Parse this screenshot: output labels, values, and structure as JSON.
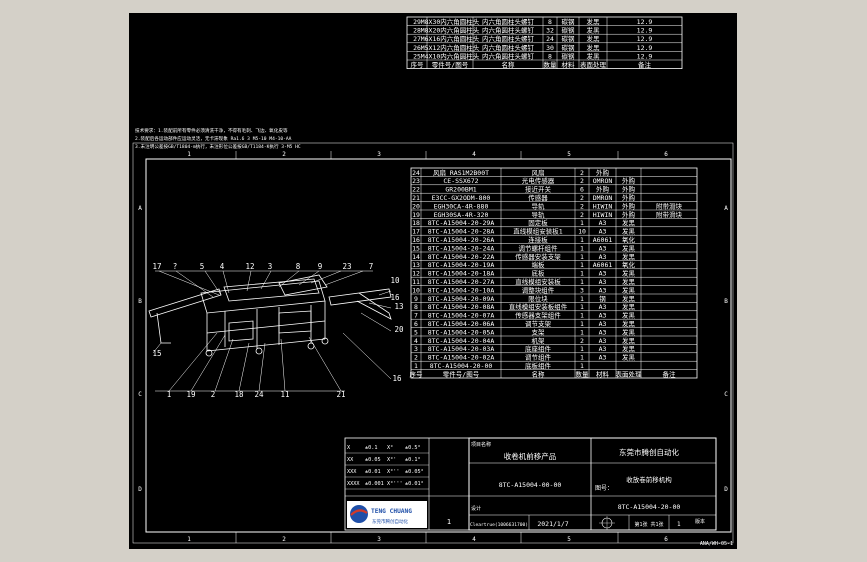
{
  "top_bom": {
    "rows": [
      {
        "no": "29",
        "part": "M8X30内六角圆柱头",
        "name": "内六角圆柱头螺钉",
        "qty": "8",
        "mat": "碳钢",
        "mark": "发黑",
        "spec": "12.9"
      },
      {
        "no": "28",
        "part": "M8X20内六角圆柱头",
        "name": "内六角圆柱头螺钉",
        "qty": "32",
        "mat": "碳钢",
        "mark": "发黑",
        "spec": "12.9"
      },
      {
        "no": "27",
        "part": "M6X16内六角圆柱头",
        "name": "内六角圆柱头螺钉",
        "qty": "24",
        "mat": "碳钢",
        "mark": "发黑",
        "spec": "12.9"
      },
      {
        "no": "26",
        "part": "M5X12内六角圆柱头",
        "name": "内六角圆柱头螺钉",
        "qty": "30",
        "mat": "碳钢",
        "mark": "发黑",
        "spec": "12.9"
      },
      {
        "no": "25",
        "part": "M4X10内六角圆柱头",
        "name": "内六角圆柱头螺钉",
        "qty": "8",
        "mat": "碳钢",
        "mark": "发黑",
        "spec": "12.9"
      }
    ],
    "header": {
      "no": "序号",
      "part": "零件号/图号",
      "name": "名称",
      "qty": "数量",
      "mat": "材料",
      "mark": "表面处理",
      "spec": "备注"
    }
  },
  "notes": [
    "技术要求：1.装配前所有零件必须清洗干净，不得有毛刺、飞边、氧化皮等",
    "2.装配后各运动部件应运动灵活，无卡滞现象 Ra1.6 3 M5-10 M4-10-AA",
    "3.未注明公差按GB/T1804-m执行，未注形位公差按GB/T1184-K执行 3-M5 HC"
  ],
  "zones": {
    "columns": [
      "1",
      "2",
      "3",
      "4",
      "5",
      "6"
    ],
    "rows": [
      "A",
      "B",
      "C",
      "D"
    ]
  },
  "callouts": {
    "top": [
      "17",
      "?",
      "5",
      "4",
      "12",
      "3",
      "8",
      "9",
      "23",
      "7"
    ],
    "right": [
      "10",
      "16",
      "13",
      "20",
      "16"
    ],
    "left": [
      "15"
    ],
    "bottom": [
      "1",
      "19",
      "2",
      "18",
      "24",
      "11",
      "21"
    ]
  },
  "main_bom": {
    "rows": [
      {
        "no": "24",
        "part": "风扇 RAS1M2B00T",
        "name": "风扇",
        "qty": "2",
        "mat": "外购",
        "mark": "",
        "spec": ""
      },
      {
        "no": "23",
        "part": "CE-SSX672",
        "name": "光电传感器",
        "qty": "2",
        "mat": "OMRON",
        "mark": "外购",
        "spec": ""
      },
      {
        "no": "22",
        "part": "GR200BM1",
        "name": "接近开关",
        "qty": "6",
        "mat": "外购",
        "mark": "外购",
        "spec": ""
      },
      {
        "no": "21",
        "part": "E3CC-GX2ODM-800",
        "name": "传感器",
        "qty": "2",
        "mat": "DMRON",
        "mark": "外购",
        "spec": ""
      },
      {
        "no": "20",
        "part": "EGH30CA-4R-880",
        "name": "导轨",
        "qty": "2",
        "mat": "HIWIN",
        "mark": "外购",
        "spec": "附带滑块"
      },
      {
        "no": "19",
        "part": "EGH30SA-4R-320",
        "name": "导轨",
        "qty": "2",
        "mat": "HIWIN",
        "mark": "外购",
        "spec": "附带滑块"
      },
      {
        "no": "18",
        "part": "8TC-A15004-20-29A",
        "name": "固定板",
        "qty": "1",
        "mat": "A3",
        "mark": "发黑",
        "spec": ""
      },
      {
        "no": "17",
        "part": "8TC-A15004-20-28A",
        "name": "直线模组安装板1",
        "qty": "10",
        "mat": "A3",
        "mark": "发黑",
        "spec": ""
      },
      {
        "no": "16",
        "part": "8TC-A15004-20-26A",
        "name": "连接板",
        "qty": "1",
        "mat": "A6061",
        "mark": "氧化",
        "spec": ""
      },
      {
        "no": "15",
        "part": "8TC-A15004-20-24A",
        "name": "调节螺杆组件",
        "qty": "1",
        "mat": "A3",
        "mark": "发黑",
        "spec": ""
      },
      {
        "no": "14",
        "part": "8TC-A15004-20-22A",
        "name": "传感器安装支架",
        "qty": "1",
        "mat": "A3",
        "mark": "发黑",
        "spec": ""
      },
      {
        "no": "13",
        "part": "8TC-A15004-20-19A",
        "name": "端板",
        "qty": "1",
        "mat": "A6061",
        "mark": "氧化",
        "spec": ""
      },
      {
        "no": "12",
        "part": "8TC-A15004-20-18A",
        "name": "底板",
        "qty": "1",
        "mat": "A3",
        "mark": "发黑",
        "spec": ""
      },
      {
        "no": "11",
        "part": "8TC-A15004-20-27A",
        "name": "直线模组安装板",
        "qty": "1",
        "mat": "A3",
        "mark": "发黑",
        "spec": ""
      },
      {
        "no": "10",
        "part": "8TC-A15004-20-10A",
        "name": "调整块组件",
        "qty": "3",
        "mat": "A3",
        "mark": "发黑",
        "spec": ""
      },
      {
        "no": "9",
        "part": "8TC-A15004-20-09A",
        "name": "限位块",
        "qty": "1",
        "mat": "钢",
        "mark": "发黑",
        "spec": ""
      },
      {
        "no": "8",
        "part": "8TC-A15004-20-08A",
        "name": "直线模组安装板组件",
        "qty": "1",
        "mat": "A3",
        "mark": "发黑",
        "spec": ""
      },
      {
        "no": "7",
        "part": "8TC-A15004-20-07A",
        "name": "传感器支架组件",
        "qty": "1",
        "mat": "A3",
        "mark": "发黑",
        "spec": ""
      },
      {
        "no": "6",
        "part": "8TC-A15004-20-06A",
        "name": "调节支架",
        "qty": "1",
        "mat": "A3",
        "mark": "发黑",
        "spec": ""
      },
      {
        "no": "5",
        "part": "8TC-A15004-20-05A",
        "name": "支架",
        "qty": "1",
        "mat": "A3",
        "mark": "发黑",
        "spec": ""
      },
      {
        "no": "4",
        "part": "8TC-A15004-20-04A",
        "name": "机架",
        "qty": "2",
        "mat": "A3",
        "mark": "发黑",
        "spec": ""
      },
      {
        "no": "3",
        "part": "8TC-A15004-20-03A",
        "name": "底座组件",
        "qty": "1",
        "mat": "A3",
        "mark": "发黑",
        "spec": ""
      },
      {
        "no": "2",
        "part": "8TC-A15004-20-02A",
        "name": "调节组件",
        "qty": "1",
        "mat": "A3",
        "mark": "发黑",
        "spec": ""
      },
      {
        "no": "1",
        "part": "8TC-A15004-20-00",
        "name": "底板组件",
        "qty": "1",
        "mat": "",
        "mark": "",
        "spec": ""
      }
    ],
    "header": {
      "no": "序号",
      "part": "零件号/图号",
      "name": "名称",
      "qty": "数量",
      "mat": "材料",
      "mark": "表面处理",
      "spec": "备注"
    }
  },
  "tolerance": [
    [
      "X",
      "±0.1",
      "X°",
      "±0.5°"
    ],
    [
      "XX",
      "±0.05",
      "X°'",
      "±0.1°"
    ],
    [
      "XXX",
      "±0.01",
      "X°''",
      "±0.05°"
    ],
    [
      "XXXX",
      "±0.001",
      "X°'''",
      "±0.01°"
    ]
  ],
  "title_block": {
    "project_label": "项目名称",
    "project": "收卷机前移产品",
    "customer": "东莞市腾创自动化",
    "drawing_no_a": "8TC-A15004-00-00",
    "drawing_no_label": "图号：",
    "drawing_no_b": "8TC-A15004-20-00",
    "part_name": "收放卷前移机构",
    "date": "2021/1/7",
    "scale": "1",
    "designer_label": "设计",
    "designer": "Cleartrue(1006631700)",
    "sheet_label": "第1张 共1张",
    "sheet": "1",
    "rev_label": "版本",
    "company_en": "TENG CHUANG",
    "company_cn": "东莞市腾创自动化",
    "corner_code": "ANA/WH-05-1"
  },
  "colors": {
    "background": "#000000",
    "lines": "#ffffff",
    "border_gray": "#d4d0c8",
    "logo_blue": "#1f4fa8",
    "logo_red": "#d23a2a"
  }
}
